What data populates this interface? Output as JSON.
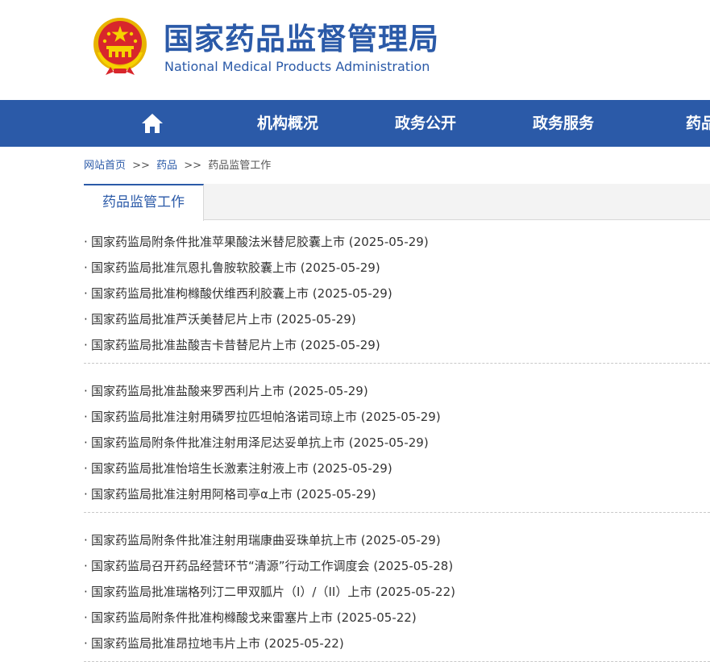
{
  "header": {
    "title": "国家药品监督管理局",
    "subtitle": "National Medical Products Administration",
    "emblem_icon": "national-emblem-icon",
    "brand_color": "#2b5aa8"
  },
  "nav": {
    "home_icon": "home-icon",
    "items": [
      {
        "label": "机构概况"
      },
      {
        "label": "政务公开"
      },
      {
        "label": "政务服务"
      },
      {
        "label": "药品"
      }
    ]
  },
  "breadcrumb": {
    "items": [
      "网站首页",
      "药品",
      "药品监管工作"
    ],
    "separator": ">>"
  },
  "tab": {
    "active_label": "药品监管工作"
  },
  "news": {
    "bullet": "·",
    "groups": [
      [
        {
          "title": "国家药监局附条件批准苹果酸法米替尼胶囊上市",
          "date": "(2025-05-29)"
        },
        {
          "title": "国家药监局批准氘恩扎鲁胺软胶囊上市",
          "date": "(2025-05-29)"
        },
        {
          "title": "国家药监局批准枸橼酸伏维西利胶囊上市",
          "date": "(2025-05-29)"
        },
        {
          "title": "国家药监局批准芦沃美替尼片上市",
          "date": "(2025-05-29)"
        },
        {
          "title": "国家药监局批准盐酸吉卡昔替尼片上市",
          "date": "(2025-05-29)"
        }
      ],
      [
        {
          "title": "国家药监局批准盐酸来罗西利片上市",
          "date": "(2025-05-29)"
        },
        {
          "title": "国家药监局批准注射用磷罗拉匹坦帕洛诺司琼上市",
          "date": "(2025-05-29)"
        },
        {
          "title": "国家药监局附条件批准注射用泽尼达妥单抗上市",
          "date": "(2025-05-29)"
        },
        {
          "title": "国家药监局批准怡培生长激素注射液上市",
          "date": "(2025-05-29)"
        },
        {
          "title": "国家药监局批准注射用阿格司亭α上市",
          "date": "(2025-05-29)"
        }
      ],
      [
        {
          "title": "国家药监局附条件批准注射用瑞康曲妥珠单抗上市",
          "date": "(2025-05-29)"
        },
        {
          "title": "国家药监局召开药品经营环节“清源”行动工作调度会",
          "date": "(2025-05-28)"
        },
        {
          "title": "国家药监局批准瑞格列汀二甲双胍片（I）/（II）上市",
          "date": "(2025-05-22)"
        },
        {
          "title": "国家药监局附条件批准枸橼酸戈来雷塞片上市",
          "date": "(2025-05-22)"
        },
        {
          "title": "国家药监局批准昂拉地韦片上市",
          "date": "(2025-05-22)"
        }
      ]
    ]
  }
}
